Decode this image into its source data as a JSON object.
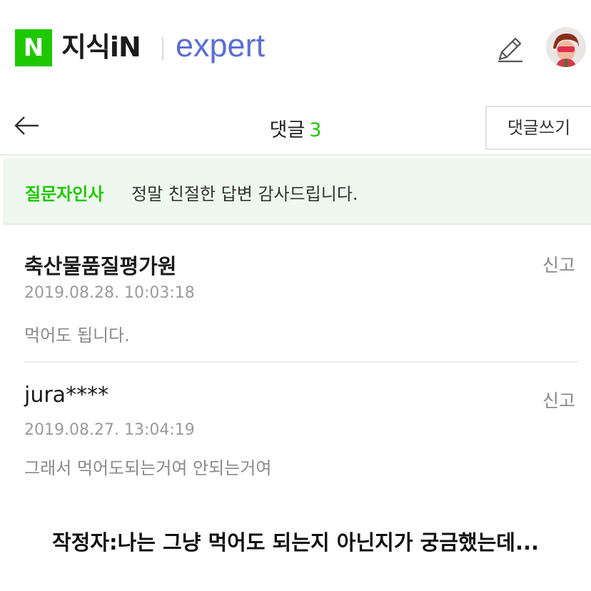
{
  "header": {
    "logo_letter": "N",
    "brand": "지식iN",
    "expert": "expert",
    "icons": [
      "pencil-icon",
      "avatar"
    ],
    "accent_color": "#1ec800",
    "expert_color": "#5a6fd6"
  },
  "nav": {
    "title": "댓글",
    "count": "3",
    "write_label": "댓글쓰기",
    "back_icon": "arrow-left-icon"
  },
  "thanks": {
    "label": "질문자인사",
    "text": "정말 친절한 답변 감사드립니다."
  },
  "comments": [
    {
      "author": "축산물품질평가원",
      "report_label": "신고",
      "date": "2019.08.28. 10:03:18",
      "body": "먹어도 됩니다."
    },
    {
      "author": "jura****",
      "report_label": "신고",
      "date": "2019.08.27. 13:04:19",
      "body": "그래서 먹어도되는거여 안되는거여"
    }
  ],
  "caption": "작정자:나는 그냥 먹어도 되는지 아닌지가 궁금했는데..."
}
